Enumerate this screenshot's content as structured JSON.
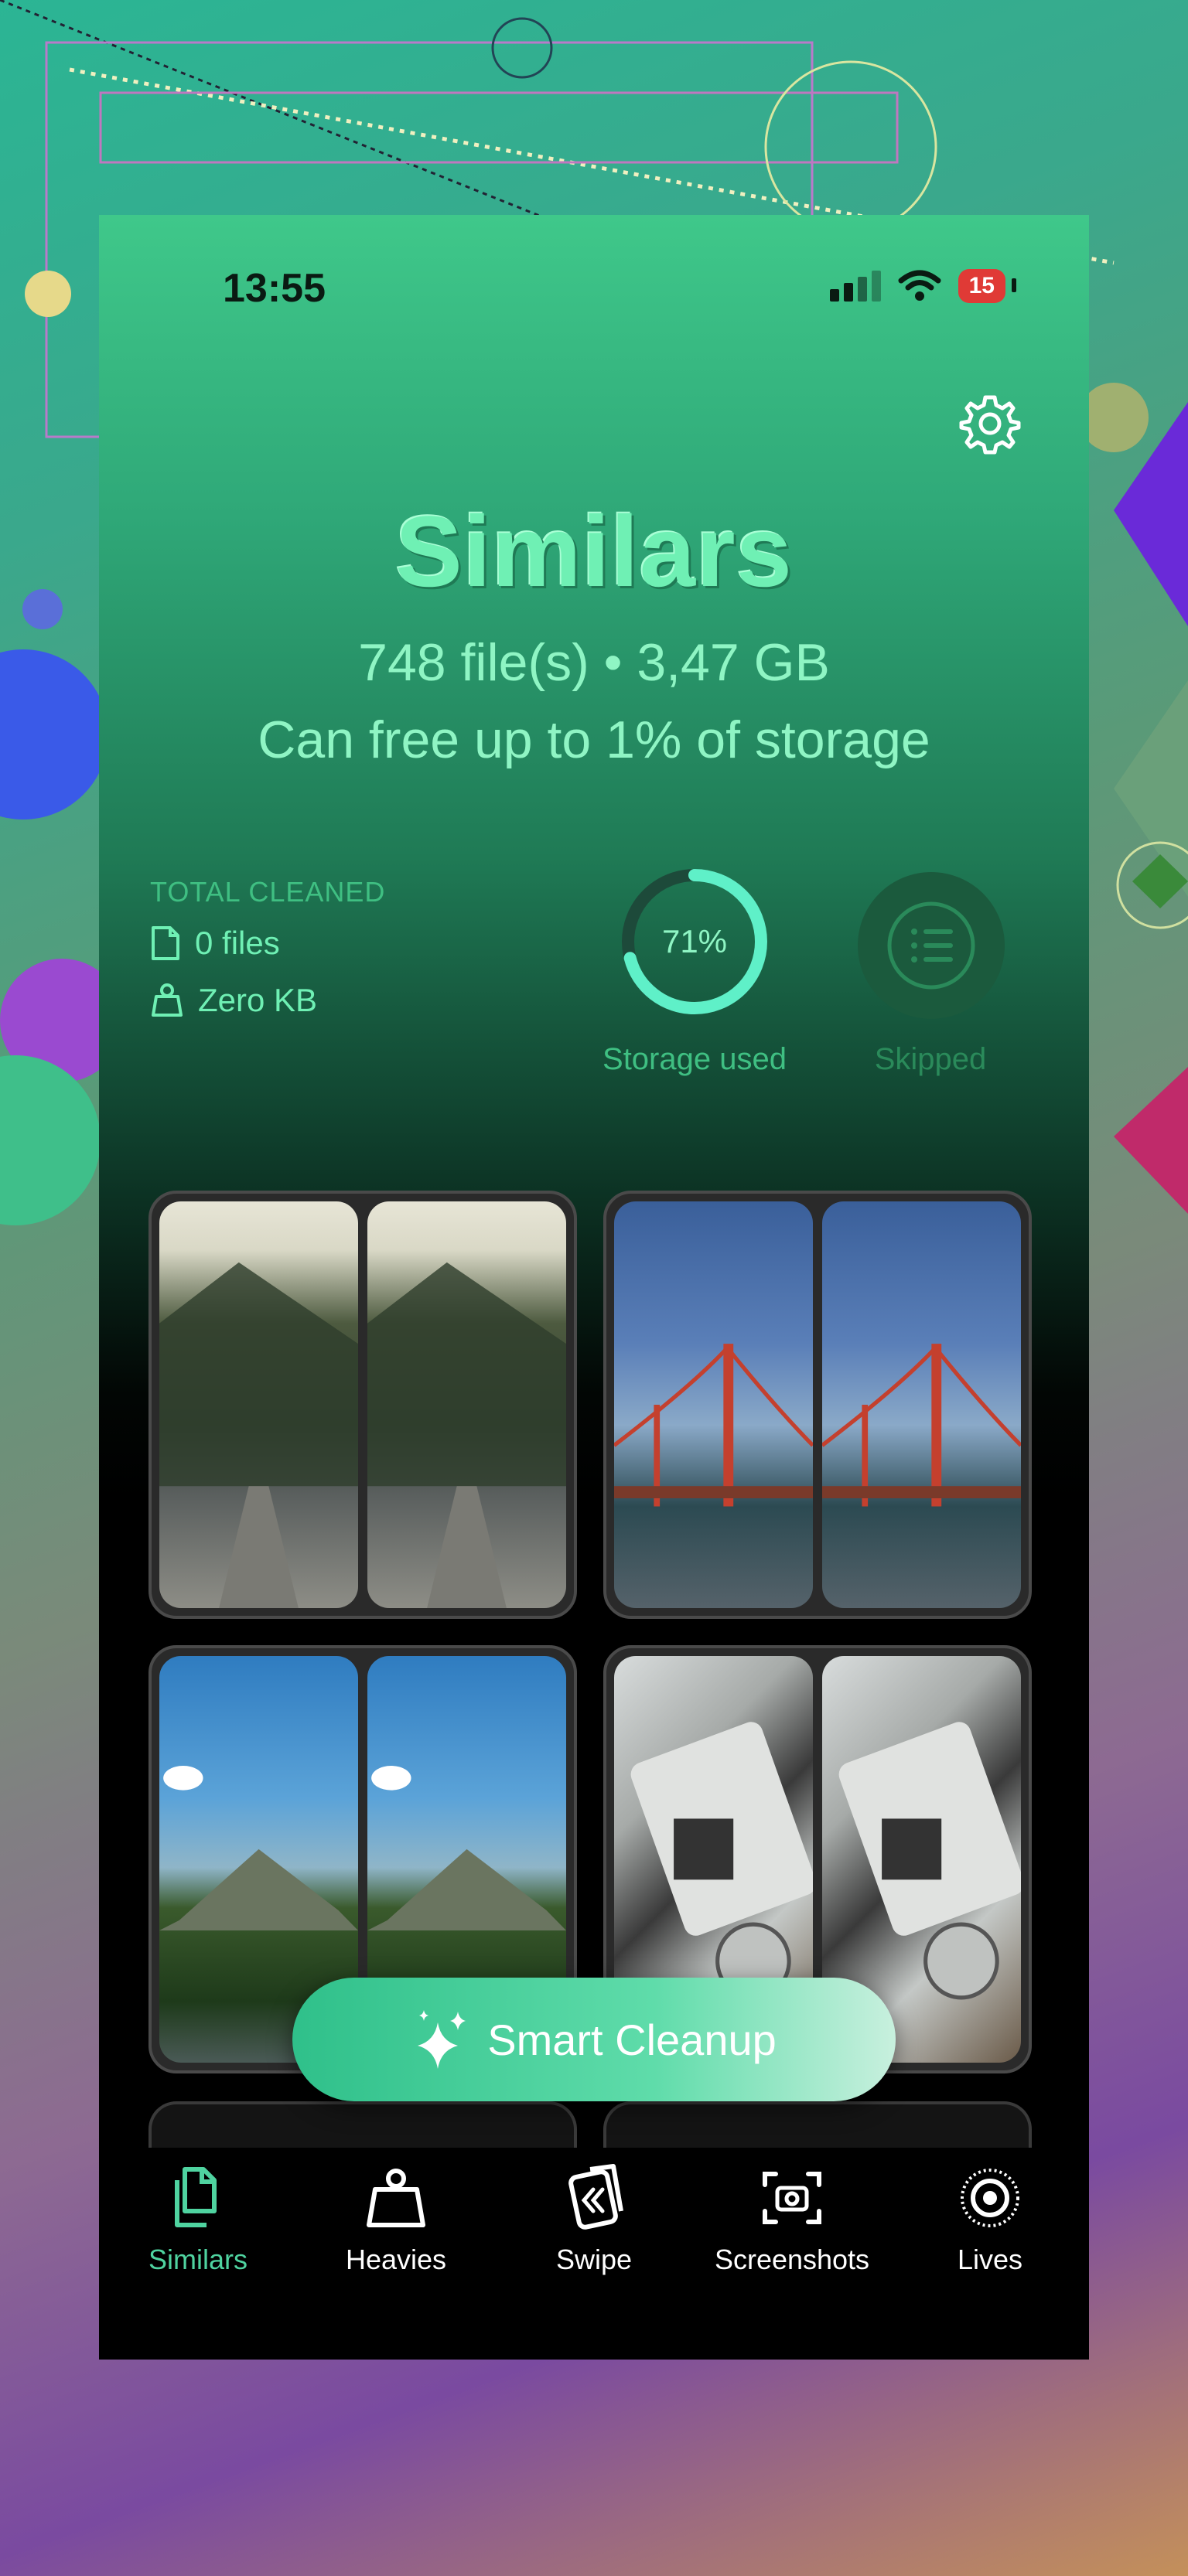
{
  "status_bar": {
    "time": "13:55",
    "battery": "15"
  },
  "header": {
    "title": "Similars",
    "summary": "748 file(s) • 3,47 GB",
    "storage_note": "Can free up to 1% of storage"
  },
  "stats": {
    "total_cleaned_label": "TOTAL CLEANED",
    "files": "0 files",
    "size": "Zero KB",
    "storage_percent": "71%",
    "storage_fraction": 0.71,
    "storage_label": "Storage used",
    "skipped_label": "Skipped"
  },
  "groups": [
    {
      "name": "mountain-road-pair"
    },
    {
      "name": "golden-gate-pair"
    },
    {
      "name": "mountain-valley-pair"
    },
    {
      "name": "fujifilm-camera-pair"
    }
  ],
  "cleanup_button": {
    "label": "Smart Cleanup"
  },
  "tabs": [
    {
      "label": "Similars",
      "icon": "similars-icon",
      "active": true
    },
    {
      "label": "Heavies",
      "icon": "weight-icon"
    },
    {
      "label": "Swipe",
      "icon": "swipe-icon"
    },
    {
      "label": "Screenshots",
      "icon": "screenshot-icon"
    },
    {
      "label": "Lives",
      "icon": "live-photo-icon"
    }
  ],
  "colors": {
    "accent": "#4fd3a0",
    "title": "#6ff0b4",
    "ring_track": "#1d4a3a",
    "ring_fill": "#5ff0c8"
  }
}
